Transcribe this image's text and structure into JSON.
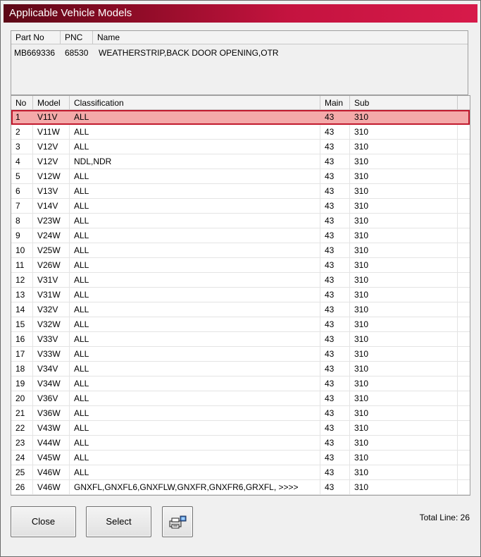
{
  "window": {
    "title": "Applicable Vehicle Models"
  },
  "part_info": {
    "headers": [
      "Part No",
      "PNC",
      "Name"
    ],
    "part_no": "MB669336",
    "pnc": "68530",
    "name": "WEATHERSTRIP,BACK DOOR OPENING,OTR"
  },
  "table": {
    "headers": [
      "No",
      "Model",
      "Classification",
      "Main",
      "Sub"
    ],
    "selected_row": 0,
    "rows": [
      {
        "no": "1",
        "model": "V11V",
        "classification": "ALL",
        "main": "43",
        "sub": "310"
      },
      {
        "no": "2",
        "model": "V11W",
        "classification": "ALL",
        "main": "43",
        "sub": "310"
      },
      {
        "no": "3",
        "model": "V12V",
        "classification": "ALL",
        "main": "43",
        "sub": "310"
      },
      {
        "no": "4",
        "model": "V12V",
        "classification": "NDL,NDR",
        "main": "43",
        "sub": "310"
      },
      {
        "no": "5",
        "model": "V12W",
        "classification": "ALL",
        "main": "43",
        "sub": "310"
      },
      {
        "no": "6",
        "model": "V13V",
        "classification": "ALL",
        "main": "43",
        "sub": "310"
      },
      {
        "no": "7",
        "model": "V14V",
        "classification": "ALL",
        "main": "43",
        "sub": "310"
      },
      {
        "no": "8",
        "model": "V23W",
        "classification": "ALL",
        "main": "43",
        "sub": "310"
      },
      {
        "no": "9",
        "model": "V24W",
        "classification": "ALL",
        "main": "43",
        "sub": "310"
      },
      {
        "no": "10",
        "model": "V25W",
        "classification": "ALL",
        "main": "43",
        "sub": "310"
      },
      {
        "no": "11",
        "model": "V26W",
        "classification": "ALL",
        "main": "43",
        "sub": "310"
      },
      {
        "no": "12",
        "model": "V31V",
        "classification": "ALL",
        "main": "43",
        "sub": "310"
      },
      {
        "no": "13",
        "model": "V31W",
        "classification": "ALL",
        "main": "43",
        "sub": "310"
      },
      {
        "no": "14",
        "model": "V32V",
        "classification": "ALL",
        "main": "43",
        "sub": "310"
      },
      {
        "no": "15",
        "model": "V32W",
        "classification": "ALL",
        "main": "43",
        "sub": "310"
      },
      {
        "no": "16",
        "model": "V33V",
        "classification": "ALL",
        "main": "43",
        "sub": "310"
      },
      {
        "no": "17",
        "model": "V33W",
        "classification": "ALL",
        "main": "43",
        "sub": "310"
      },
      {
        "no": "18",
        "model": "V34V",
        "classification": "ALL",
        "main": "43",
        "sub": "310"
      },
      {
        "no": "19",
        "model": "V34W",
        "classification": "ALL",
        "main": "43",
        "sub": "310"
      },
      {
        "no": "20",
        "model": "V36V",
        "classification": "ALL",
        "main": "43",
        "sub": "310"
      },
      {
        "no": "21",
        "model": "V36W",
        "classification": "ALL",
        "main": "43",
        "sub": "310"
      },
      {
        "no": "22",
        "model": "V43W",
        "classification": "ALL",
        "main": "43",
        "sub": "310"
      },
      {
        "no": "23",
        "model": "V44W",
        "classification": "ALL",
        "main": "43",
        "sub": "310"
      },
      {
        "no": "24",
        "model": "V45W",
        "classification": "ALL",
        "main": "43",
        "sub": "310"
      },
      {
        "no": "25",
        "model": "V46W",
        "classification": "ALL",
        "main": "43",
        "sub": "310"
      },
      {
        "no": "26",
        "model": "V46W",
        "classification": "GNXFL,GNXFL6,GNXFLW,GNXFR,GNXFR6,GRXFL,  >>>>",
        "main": "43",
        "sub": "310"
      }
    ]
  },
  "buttons": {
    "close": "Close",
    "select": "Select",
    "print_icon": "printer-icon"
  },
  "footer": {
    "total_line": "Total Line: 26"
  },
  "colors": {
    "title_gradient_start": "#5c0716",
    "title_gradient_end": "#d71a4a",
    "selected_row_bg": "#f4a9a9",
    "selected_row_border": "#c21a2e"
  }
}
